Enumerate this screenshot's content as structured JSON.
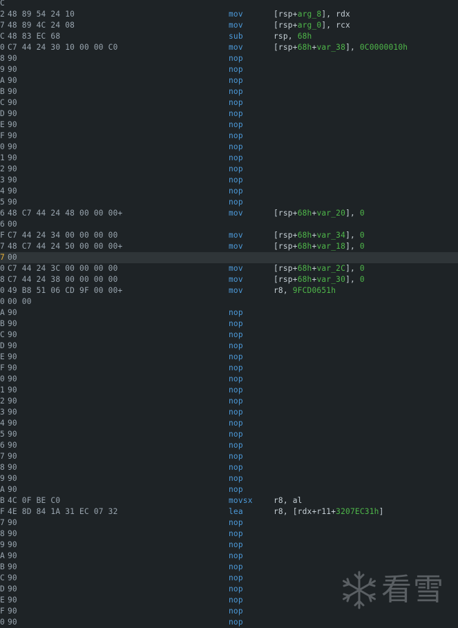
{
  "listing": [
    {
      "prefix": "C",
      "bytes": "",
      "mnemonic": "",
      "operands": []
    },
    {
      "prefix": "2",
      "bytes": "48 89 54 24 10",
      "mnemonic": "mov",
      "operands": [
        {
          "t": "[rsp+"
        },
        {
          "t": "arg_8",
          "c": "g"
        },
        {
          "t": "], rdx"
        }
      ]
    },
    {
      "prefix": "7",
      "bytes": "48 89 4C 24 08",
      "mnemonic": "mov",
      "operands": [
        {
          "t": "[rsp+"
        },
        {
          "t": "arg_0",
          "c": "g"
        },
        {
          "t": "], rcx"
        }
      ]
    },
    {
      "prefix": "C",
      "bytes": "48 83 EC 68",
      "mnemonic": "sub",
      "operands": [
        {
          "t": "rsp, "
        },
        {
          "t": "68h",
          "c": "g"
        }
      ]
    },
    {
      "prefix": "0",
      "bytes": "C7 44 24 30 10 00 00 C0",
      "mnemonic": "mov",
      "operands": [
        {
          "t": "[rsp+"
        },
        {
          "t": "68h",
          "c": "g"
        },
        {
          "t": "+"
        },
        {
          "t": "var_38",
          "c": "g"
        },
        {
          "t": "], "
        },
        {
          "t": "0C0000010h",
          "c": "g"
        }
      ]
    },
    {
      "prefix": "8",
      "bytes": "90",
      "mnemonic": "nop",
      "operands": []
    },
    {
      "prefix": "9",
      "bytes": "90",
      "mnemonic": "nop",
      "operands": []
    },
    {
      "prefix": "A",
      "bytes": "90",
      "mnemonic": "nop",
      "operands": []
    },
    {
      "prefix": "B",
      "bytes": "90",
      "mnemonic": "nop",
      "operands": []
    },
    {
      "prefix": "C",
      "bytes": "90",
      "mnemonic": "nop",
      "operands": []
    },
    {
      "prefix": "D",
      "bytes": "90",
      "mnemonic": "nop",
      "operands": []
    },
    {
      "prefix": "E",
      "bytes": "90",
      "mnemonic": "nop",
      "operands": []
    },
    {
      "prefix": "F",
      "bytes": "90",
      "mnemonic": "nop",
      "operands": []
    },
    {
      "prefix": "0",
      "bytes": "90",
      "mnemonic": "nop",
      "operands": []
    },
    {
      "prefix": "1",
      "bytes": "90",
      "mnemonic": "nop",
      "operands": []
    },
    {
      "prefix": "2",
      "bytes": "90",
      "mnemonic": "nop",
      "operands": []
    },
    {
      "prefix": "3",
      "bytes": "90",
      "mnemonic": "nop",
      "operands": []
    },
    {
      "prefix": "4",
      "bytes": "90",
      "mnemonic": "nop",
      "operands": []
    },
    {
      "prefix": "5",
      "bytes": "90",
      "mnemonic": "nop",
      "operands": []
    },
    {
      "prefix": "6",
      "bytes": "48 C7 44 24 48 00 00 00+",
      "mnemonic": "mov",
      "operands": [
        {
          "t": "[rsp+"
        },
        {
          "t": "68h",
          "c": "g"
        },
        {
          "t": "+"
        },
        {
          "t": "var_20",
          "c": "g"
        },
        {
          "t": "], "
        },
        {
          "t": "0",
          "c": "g"
        }
      ]
    },
    {
      "prefix": "6",
      "bytes": "00",
      "mnemonic": "",
      "operands": []
    },
    {
      "prefix": "F",
      "bytes": "C7 44 24 34 00 00 00 00",
      "mnemonic": "mov",
      "operands": [
        {
          "t": "[rsp+"
        },
        {
          "t": "68h",
          "c": "g"
        },
        {
          "t": "+"
        },
        {
          "t": "var_34",
          "c": "g"
        },
        {
          "t": "], "
        },
        {
          "t": "0",
          "c": "g"
        }
      ]
    },
    {
      "prefix": "7",
      "bytes": "48 C7 44 24 50 00 00 00+",
      "mnemonic": "mov",
      "operands": [
        {
          "t": "[rsp+"
        },
        {
          "t": "68h",
          "c": "g"
        },
        {
          "t": "+"
        },
        {
          "t": "var_18",
          "c": "g"
        },
        {
          "t": "], "
        },
        {
          "t": "0",
          "c": "g"
        }
      ]
    },
    {
      "prefix": "7",
      "bytes": "00",
      "mnemonic": "",
      "operands": [],
      "highlight": true
    },
    {
      "prefix": "0",
      "bytes": "C7 44 24 3C 00 00 00 00",
      "mnemonic": "mov",
      "operands": [
        {
          "t": "[rsp+"
        },
        {
          "t": "68h",
          "c": "g"
        },
        {
          "t": "+"
        },
        {
          "t": "var_2C",
          "c": "g"
        },
        {
          "t": "], "
        },
        {
          "t": "0",
          "c": "g"
        }
      ]
    },
    {
      "prefix": "8",
      "bytes": "C7 44 24 38 00 00 00 00",
      "mnemonic": "mov",
      "operands": [
        {
          "t": "[rsp+"
        },
        {
          "t": "68h",
          "c": "g"
        },
        {
          "t": "+"
        },
        {
          "t": "var_30",
          "c": "g"
        },
        {
          "t": "], "
        },
        {
          "t": "0",
          "c": "g"
        }
      ]
    },
    {
      "prefix": "0",
      "bytes": "49 B8 51 06 CD 9F 00 00+",
      "mnemonic": "mov",
      "operands": [
        {
          "t": "r8, "
        },
        {
          "t": "9FCD0651h",
          "c": "g"
        }
      ]
    },
    {
      "prefix": "0",
      "bytes": "00 00",
      "mnemonic": "",
      "operands": []
    },
    {
      "prefix": "A",
      "bytes": "90",
      "mnemonic": "nop",
      "operands": []
    },
    {
      "prefix": "B",
      "bytes": "90",
      "mnemonic": "nop",
      "operands": []
    },
    {
      "prefix": "C",
      "bytes": "90",
      "mnemonic": "nop",
      "operands": []
    },
    {
      "prefix": "D",
      "bytes": "90",
      "mnemonic": "nop",
      "operands": []
    },
    {
      "prefix": "E",
      "bytes": "90",
      "mnemonic": "nop",
      "operands": []
    },
    {
      "prefix": "F",
      "bytes": "90",
      "mnemonic": "nop",
      "operands": []
    },
    {
      "prefix": "0",
      "bytes": "90",
      "mnemonic": "nop",
      "operands": []
    },
    {
      "prefix": "1",
      "bytes": "90",
      "mnemonic": "nop",
      "operands": []
    },
    {
      "prefix": "2",
      "bytes": "90",
      "mnemonic": "nop",
      "operands": []
    },
    {
      "prefix": "3",
      "bytes": "90",
      "mnemonic": "nop",
      "operands": []
    },
    {
      "prefix": "4",
      "bytes": "90",
      "mnemonic": "nop",
      "operands": []
    },
    {
      "prefix": "5",
      "bytes": "90",
      "mnemonic": "nop",
      "operands": []
    },
    {
      "prefix": "6",
      "bytes": "90",
      "mnemonic": "nop",
      "operands": []
    },
    {
      "prefix": "7",
      "bytes": "90",
      "mnemonic": "nop",
      "operands": []
    },
    {
      "prefix": "8",
      "bytes": "90",
      "mnemonic": "nop",
      "operands": []
    },
    {
      "prefix": "9",
      "bytes": "90",
      "mnemonic": "nop",
      "operands": []
    },
    {
      "prefix": "A",
      "bytes": "90",
      "mnemonic": "nop",
      "operands": []
    },
    {
      "prefix": "B",
      "bytes": "4C 0F BE C0",
      "mnemonic": "movsx",
      "operands": [
        {
          "t": "r8, al"
        }
      ]
    },
    {
      "prefix": "F",
      "bytes": "4E 8D 84 1A 31 EC 07 32",
      "mnemonic": "lea",
      "operands": [
        {
          "t": "r8, [rdx+r11+"
        },
        {
          "t": "3207EC31h",
          "c": "g"
        },
        {
          "t": "]"
        }
      ]
    },
    {
      "prefix": "7",
      "bytes": "90",
      "mnemonic": "nop",
      "operands": []
    },
    {
      "prefix": "8",
      "bytes": "90",
      "mnemonic": "nop",
      "operands": []
    },
    {
      "prefix": "9",
      "bytes": "90",
      "mnemonic": "nop",
      "operands": []
    },
    {
      "prefix": "A",
      "bytes": "90",
      "mnemonic": "nop",
      "operands": []
    },
    {
      "prefix": "B",
      "bytes": "90",
      "mnemonic": "nop",
      "operands": []
    },
    {
      "prefix": "C",
      "bytes": "90",
      "mnemonic": "nop",
      "operands": []
    },
    {
      "prefix": "D",
      "bytes": "90",
      "mnemonic": "nop",
      "operands": []
    },
    {
      "prefix": "E",
      "bytes": "90",
      "mnemonic": "nop",
      "operands": []
    },
    {
      "prefix": "F",
      "bytes": "90",
      "mnemonic": "nop",
      "operands": []
    },
    {
      "prefix": "0",
      "bytes": "90",
      "mnemonic": "nop",
      "operands": []
    }
  ],
  "highlight_prefix_color": "#e8b23a",
  "watermark": {
    "text": "看雪",
    "icon": "snowflake-icon"
  }
}
